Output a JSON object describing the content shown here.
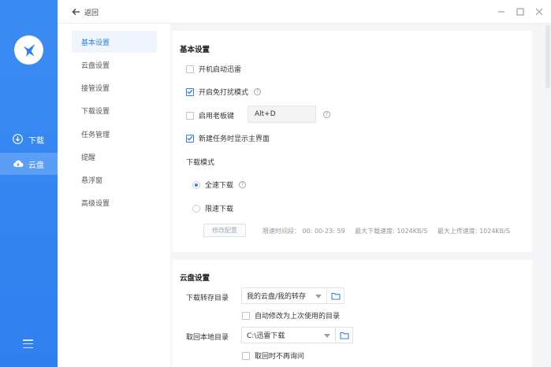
{
  "rail": {
    "items": [
      {
        "label": "下载",
        "icon": "download-icon"
      },
      {
        "label": "云盘",
        "icon": "cloud-icon"
      }
    ],
    "active_index": 1,
    "accent": "#2f7ff0"
  },
  "topbar": {
    "back_label": "返回"
  },
  "nav": {
    "items": [
      "基本设置",
      "云盘设置",
      "接管设置",
      "下载设置",
      "任务管理",
      "提醒",
      "悬浮窗",
      "高级设置"
    ],
    "active_index": 0
  },
  "basic": {
    "title": "基本设置",
    "autostart_label": "开机启动迅雷",
    "autostart_checked": false,
    "nodisturb_label": "开启免打扰模式",
    "nodisturb_checked": true,
    "bosskey_label": "启用老板键",
    "bosskey_checked": false,
    "bosskey_value": "Alt+D",
    "show_main_label": "新建任务时显示主界面",
    "show_main_checked": true,
    "download_mode_title": "下载模式",
    "mode_full_label": "全速下载",
    "mode_limit_label": "限速下载",
    "selected_mode": "全速下载",
    "modify_button": "修改配置",
    "limit_time": "限速时间段： 00: 00-23: 59",
    "limit_down": "最大下载速度: 1024KB/S",
    "limit_up": "最大上传速度: 1024KB/S"
  },
  "cloud": {
    "title": "云盘设置",
    "save_dir_label": "下载转存目录",
    "save_dir_value": "我的云盘/我的转存",
    "auto_change_label": "自动修改为上次使用的目录",
    "auto_change_checked": false,
    "local_dir_label": "取回本地目录",
    "local_dir_value": "C:\\迅雷下载",
    "no_ask_label": "取回时不再询问",
    "no_ask_checked": false
  }
}
